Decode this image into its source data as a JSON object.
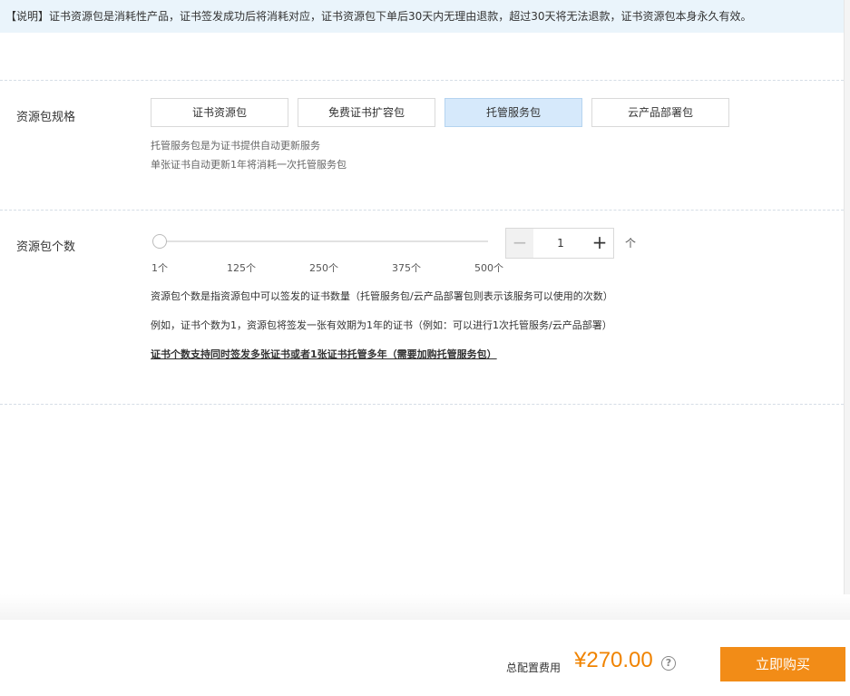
{
  "notice": {
    "text": "【说明】证书资源包是消耗性产品，证书签发成功后将消耗对应，证书资源包下单后30天内无理由退款，超过30天将无法退款，证书资源包本身永久有效。"
  },
  "spec": {
    "label": "资源包规格",
    "options": [
      {
        "label": "证书资源包",
        "selected": false
      },
      {
        "label": "免费证书扩容包",
        "selected": false
      },
      {
        "label": "托管服务包",
        "selected": true
      },
      {
        "label": "云产品部署包",
        "selected": false
      }
    ],
    "desc_line1": "托管服务包是为证书提供自动更新服务",
    "desc_line2": "单张证书自动更新1年将消耗一次托管服务包"
  },
  "quantity": {
    "label": "资源包个数",
    "slider": {
      "value": 1,
      "min": 1,
      "max": 500
    },
    "ticks": [
      "1个",
      "125个",
      "250个",
      "375个",
      "500个"
    ],
    "stepper_value": "1",
    "minus_symbol": "−",
    "plus_symbol": "+",
    "unit": "个",
    "para1": "资源包个数是指资源包中可以签发的证书数量（托管服务包/云产品部署包则表示该服务可以使用的次数）",
    "para2": "例如，证书个数为1，资源包将签发一张有效期为1年的证书（例如：可以进行1次托管服务/云产品部署）",
    "link": "证书个数支持同时签发多张证书或者1张证书托管多年（需要加购托管服务包）"
  },
  "footer": {
    "total_label": "总配置费用",
    "price": "¥270.00",
    "help_symbol": "?",
    "buy_label": "立即购买"
  },
  "colors": {
    "accent": "#f28c17",
    "price": "#f08300",
    "selected": "#d6e9fb"
  }
}
